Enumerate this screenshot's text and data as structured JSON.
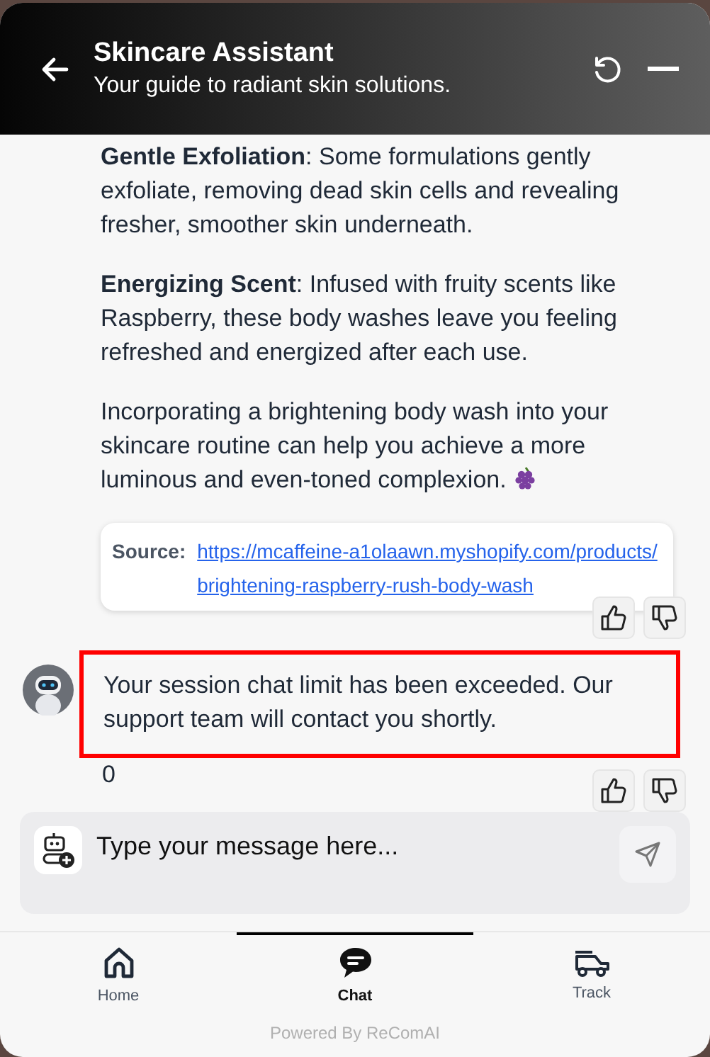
{
  "header": {
    "title": "Skincare Assistant",
    "subtitle": "Your guide to radiant skin solutions."
  },
  "messages": [
    {
      "kind": "answer",
      "paragraphs": [
        "**Gentle Exfoliation**: Some formulations gently exfoliate, removing dead skin cells and revealing fresher, smoother skin underneath.",
        "**Energizing Scent**: Infused with fruity scents like Raspberry, these body washes leave you feeling refreshed and energized after each use.",
        "Incorporating a brightening body wash into your skincare routine can help you achieve a more luminous and even-toned complexion."
      ],
      "source": {
        "label": "Source:",
        "url": "https://mcaffeine-a1olaawn.myshopify.com/products/brightening-raspberry-rush-body-wash"
      }
    },
    {
      "kind": "notice",
      "highlighted": true,
      "text": "Your session chat limit has been exceeded. Our support team will contact you shortly.",
      "extra": "0"
    }
  ],
  "input": {
    "placeholder": "Type your message here..."
  },
  "nav": [
    {
      "label": "Home",
      "selected": false
    },
    {
      "label": "Chat",
      "selected": true
    },
    {
      "label": "Track",
      "selected": false
    }
  ],
  "footer": "Powered By ReComAI"
}
